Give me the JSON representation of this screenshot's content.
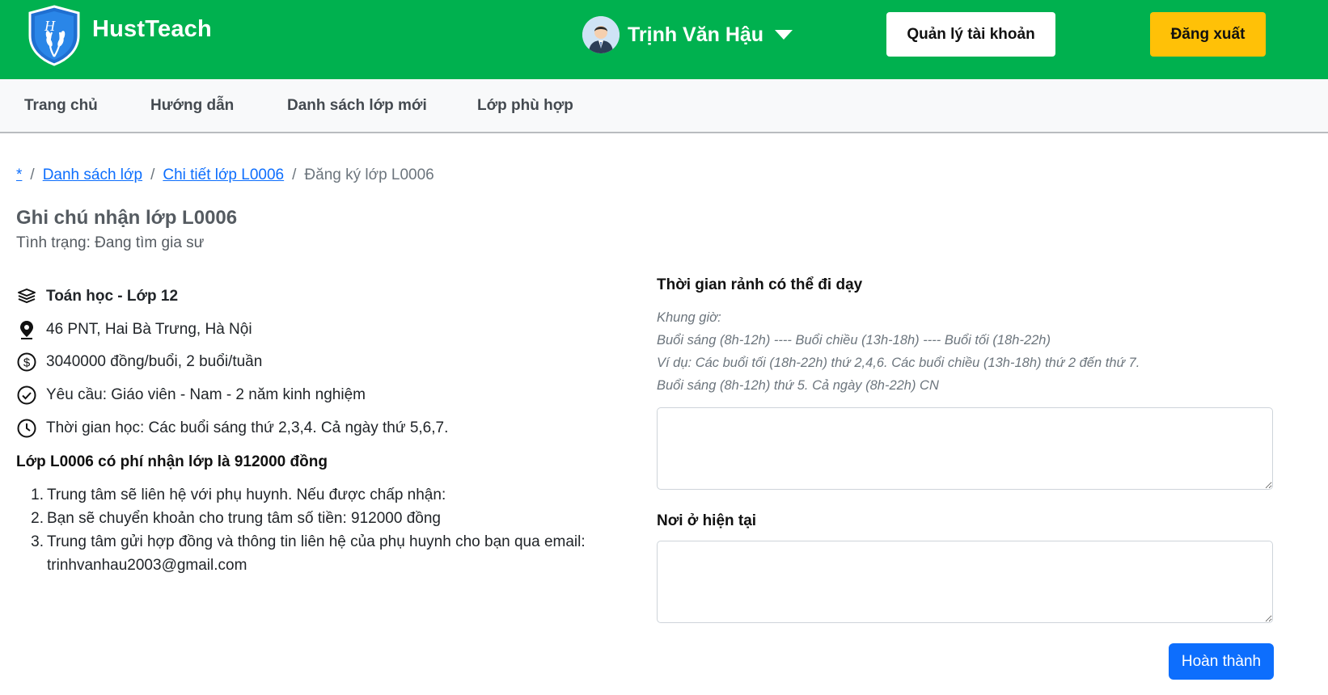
{
  "header": {
    "brand": "HustTeach",
    "logo_letter": "H",
    "user_name": "Trịnh Văn Hậu",
    "account_button": "Quản lý tài khoản",
    "logout_button": "Đăng xuất",
    "colors": {
      "bar": "#00b14f",
      "logout": "#ffc107"
    }
  },
  "nav": {
    "items": [
      "Trang chủ",
      "Hướng dẫn",
      "Danh sách lớp mới",
      "Lớp phù hợp"
    ]
  },
  "breadcrumb": {
    "items": [
      "*",
      "Danh sách lớp",
      "Chi tiết lớp L0006"
    ],
    "current": "Đăng ký lớp L0006",
    "separator": "/"
  },
  "page": {
    "title": "Ghi chú nhận lớp L0006",
    "status": "Tình trạng: Đang tìm gia sư"
  },
  "class_info": {
    "subject": "Toán học - Lớp 12",
    "address": "46 PNT, Hai Bà Trưng, Hà Nội",
    "price": "3040000 đồng/buổi, 2 buổi/tuần",
    "requirement": "Yêu cầu: Giáo viên - Nam - 2 năm kinh nghiệm",
    "schedule": "Thời gian học: Các buổi sáng thứ 2,3,4. Cả ngày thứ 5,6,7.",
    "icons": [
      "books-icon",
      "location-pin-icon",
      "dollar-circle-icon",
      "check-circle-icon",
      "clock-icon"
    ]
  },
  "fee_note": "Lớp L0006 có phí nhận lớp là 912000 đồng",
  "steps": [
    "Trung tâm sẽ liên hệ với phụ huynh. Nếu được chấp nhận:",
    "Bạn sẽ chuyển khoản cho trung tâm số tiền: 912000 đồng",
    "Trung tâm gửi hợp đồng và thông tin liên hệ của phụ huynh cho bạn qua email:",
    "trinhvanhau2003@gmail.com"
  ],
  "form": {
    "free_time_label": "Thời gian rảnh có thể đi dạy",
    "hints": [
      "Khung giờ:",
      "Buổi sáng (8h-12h) ---- Buổi chiều (13h-18h) ---- Buổi tối (18h-22h)",
      "Ví dụ: Các buổi tối (18h-22h) thứ 2,4,6. Các buổi chiều (13h-18h) thứ 2 đến thứ 7.",
      "Buổi sáng (8h-12h) thứ 5. Cả ngày (8h-22h) CN"
    ],
    "free_time_value": "",
    "residence_label": "Nơi ở hiện tại",
    "residence_value": "",
    "submit": "Hoàn thành"
  }
}
